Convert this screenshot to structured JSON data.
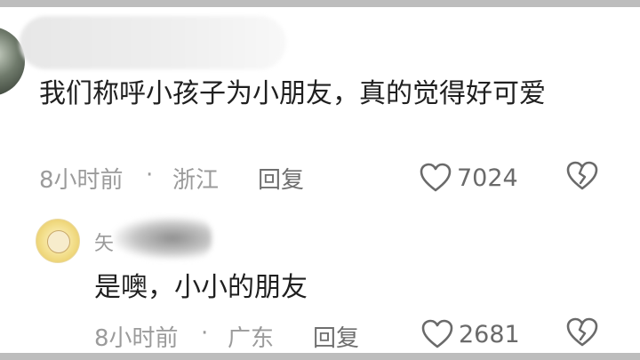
{
  "comment": {
    "text": "我们称呼小孩子为小朋友，真的觉得好可爱",
    "time": "8小时前",
    "sep": "·",
    "location": "浙江",
    "reply_label": "回复",
    "likes": "7024"
  },
  "reply": {
    "name_partial": "矢",
    "text": "是噢，小小的朋友",
    "time": "8小时前",
    "sep": "·",
    "location": "广东",
    "reply_label": "回复",
    "likes": "2681"
  },
  "icons": {
    "like": "heart-outline-icon",
    "dislike": "broken-heart-icon"
  },
  "colors": {
    "text": "#1f1f1f",
    "meta": "#9b9b9b",
    "icon": "#6a6a6a"
  }
}
